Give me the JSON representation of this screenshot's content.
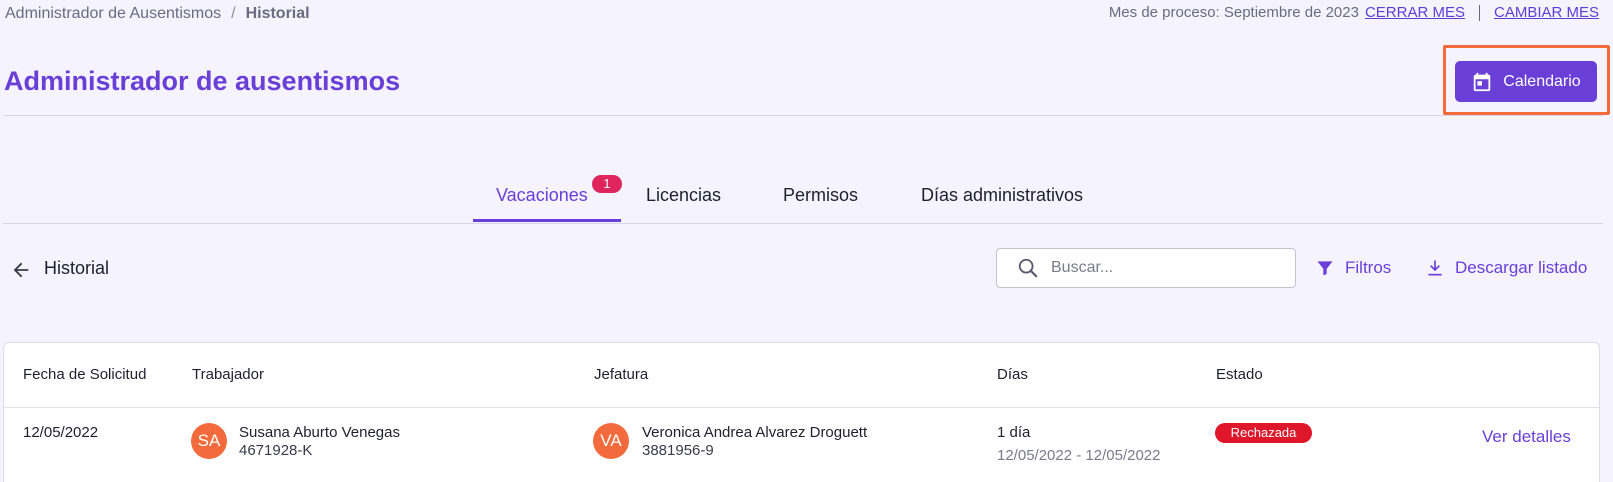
{
  "breadcrumb": {
    "root": "Administrador de Ausentismos",
    "separator": "/",
    "current": "Historial"
  },
  "process": {
    "label": "Mes de proceso: Septiembre de 2023",
    "close_month": "CERRAR MES",
    "change_month": "CAMBIAR MES"
  },
  "page": {
    "title": "Administrador de ausentismos",
    "calendar_button": "Calendario"
  },
  "tabs": [
    {
      "label": "Vacaciones",
      "badge": "1",
      "active": true
    },
    {
      "label": "Licencias"
    },
    {
      "label": "Permisos"
    },
    {
      "label": "Días administrativos"
    }
  ],
  "section": {
    "title": "Historial",
    "search_placeholder": "Buscar...",
    "filters_label": "Filtros",
    "download_label": "Descargar listado"
  },
  "table": {
    "headers": [
      "Fecha de Solicitud",
      "Trabajador",
      "Jefatura",
      "Días",
      "Estado"
    ],
    "rows": [
      {
        "date": "12/05/2022",
        "worker_initials": "SA",
        "worker_name": "Susana Aburto Venegas",
        "worker_id": "4671928-K",
        "boss_initials": "VA",
        "boss_name": "Veronica Andrea Alvarez Droguett",
        "boss_id": "3881956-9",
        "days": "1 día",
        "range": "12/05/2022 - 12/05/2022",
        "status": "Rechazada",
        "action": "Ver detalles"
      }
    ]
  },
  "colors": {
    "accent": "#6a3fd8",
    "highlight": "#f26b3a",
    "badge": "#e0245e",
    "rejected": "#e0162b",
    "avatar": "#f36b3c"
  }
}
